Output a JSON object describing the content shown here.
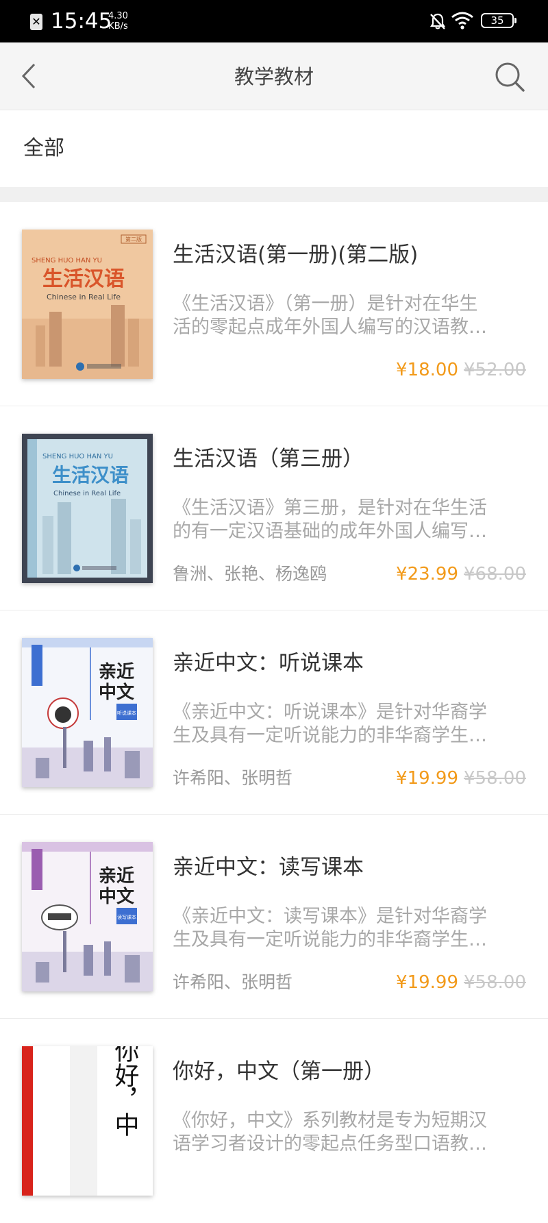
{
  "status_bar": {
    "time": "15:45",
    "speed_value": "4.30",
    "speed_unit": "KB/s",
    "battery": "35"
  },
  "header": {
    "title": "教学教材"
  },
  "category": {
    "selected": "全部"
  },
  "books": [
    {
      "title": "生活汉语(第一册)(第二版)",
      "desc_line1": "《生活汉语》（第一册）是针对在华生",
      "desc_line2": "活的零起点成年外国人编写的汉语教…",
      "authors": "",
      "price": "¥18.00",
      "original_price": "¥52.00",
      "cover": {
        "pinyin": "SHENG HUO HAN YU",
        "cn": "生活汉语",
        "en": "Chinese in Real Life",
        "bg": "#f0c8a0",
        "accent": "#d9552a"
      }
    },
    {
      "title": "生活汉语（第三册）",
      "desc_line1": "《生活汉语》第三册，是针对在华生活",
      "desc_line2": "的有一定汉语基础的成年外国人编写…",
      "authors": "鲁洲、张艳、杨逸鸥",
      "price": "¥23.99",
      "original_price": "¥68.00",
      "cover": {
        "pinyin": "SHENG HUO HAN YU",
        "cn": "生活汉语",
        "en": "Chinese in Real Life",
        "bg": "#cfe3ec",
        "accent": "#3d8fc9"
      }
    },
    {
      "title": "亲近中文：听说课本",
      "desc_line1": "《亲近中文：听说课本》是针对华裔学",
      "desc_line2": "生及具有一定听说能力的非华裔学生…",
      "authors": "许希阳、张明哲",
      "price": "¥19.99",
      "original_price": "¥58.00",
      "cover": {
        "cn1": "亲近",
        "cn2": "中文",
        "badge": "听说课本",
        "bg": "#f4f6fb",
        "accent": "#3d6fd1"
      }
    },
    {
      "title": "亲近中文：读写课本",
      "desc_line1": "《亲近中文：读写课本》是针对华裔学",
      "desc_line2": "生及具有一定听说能力的非华裔学生…",
      "authors": "许希阳、张明哲",
      "price": "¥19.99",
      "original_price": "¥58.00",
      "cover": {
        "cn1": "亲近",
        "cn2": "中文",
        "badge": "读写课本",
        "bg": "#f6f2f8",
        "accent": "#9a5db0"
      }
    },
    {
      "title": "你好，中文（第一册）",
      "desc_line1": "《你好，中文》系列教材是专为短期汉",
      "desc_line2": "语学习者设计的零起点任务型口语教…",
      "authors": "",
      "price": "",
      "original_price": "",
      "cover": {
        "cn": "你好，中",
        "bg": "#ffffff",
        "accent": "#d8231b"
      }
    }
  ],
  "colors": {
    "price": "#f29a1a",
    "original_price": "#c8c8c8",
    "header_bg": "#f5f5f5"
  },
  "icons": [
    "close-box-icon",
    "bell-off-icon",
    "wifi-icon",
    "battery-icon",
    "back-arrow-icon",
    "search-icon"
  ]
}
